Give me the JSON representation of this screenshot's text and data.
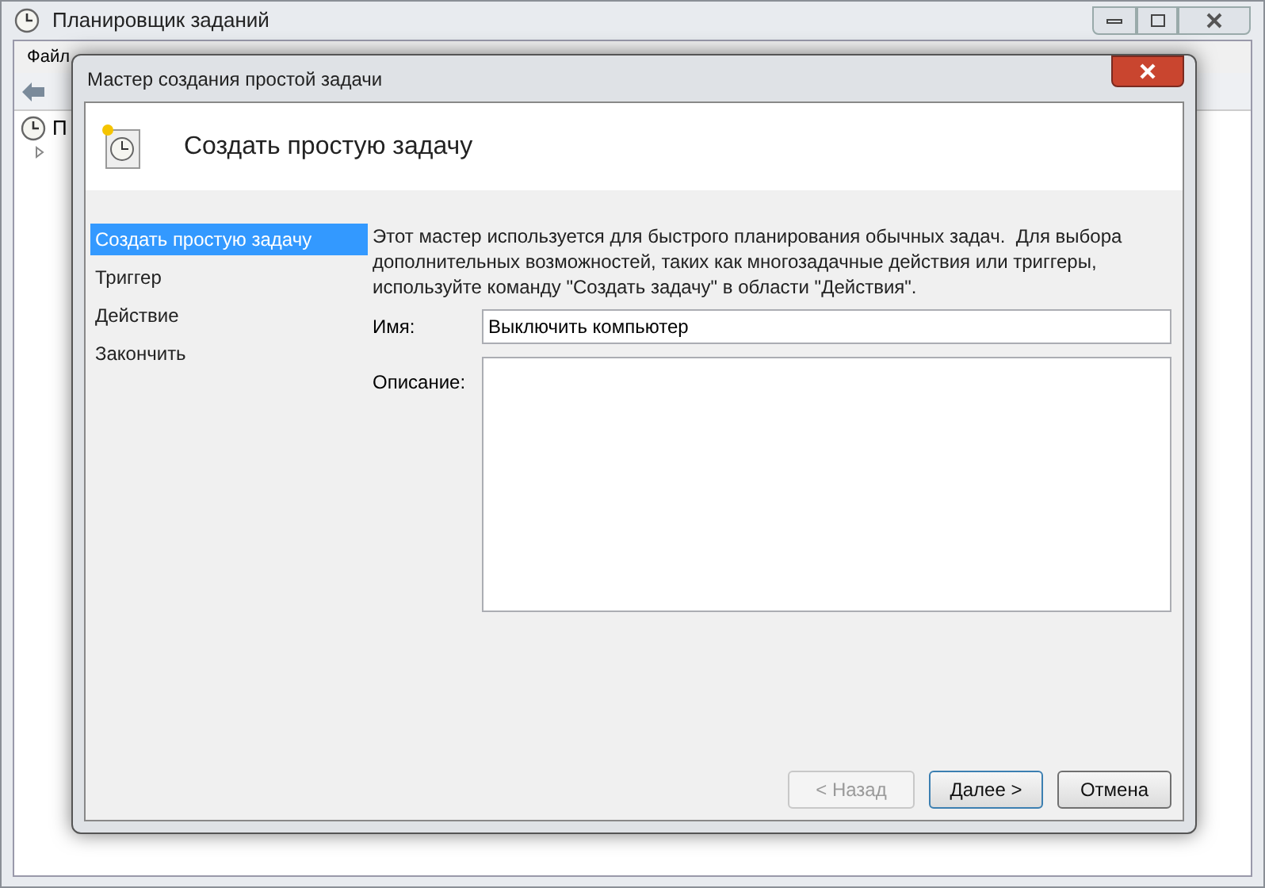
{
  "main_window": {
    "title": "Планировщик заданий",
    "menu": [
      "Файл"
    ],
    "tree_item": "П"
  },
  "dialog": {
    "title": "Мастер создания простой задачи",
    "heading": "Создать простую задачу",
    "steps": [
      {
        "label": "Создать простую задачу",
        "selected": true
      },
      {
        "label": "Триггер",
        "selected": false
      },
      {
        "label": "Действие",
        "selected": false
      },
      {
        "label": "Закончить",
        "selected": false
      }
    ],
    "intro": "Этот мастер используется для быстрого планирования обычных задач.  Для выбора дополнительных возможностей, таких как многозадачные действия или триггеры, используйте команду \"Создать задачу\" в области \"Действия\".",
    "name_label": "Имя:",
    "name_value": "Выключить компьютер",
    "description_label": "Описание:",
    "buttons": [
      {
        "label": "< Назад",
        "disabled": true,
        "default": false
      },
      {
        "label": "Далее >",
        "disabled": false,
        "default": true
      },
      {
        "label": "Отмена",
        "disabled": false,
        "default": false
      }
    ]
  }
}
